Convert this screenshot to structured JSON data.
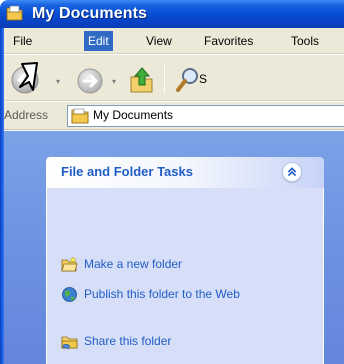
{
  "window": {
    "title": "My Documents",
    "title_icon": "folder-icon",
    "colors": {
      "titlebar": "#0a52d6",
      "menu_highlight": "#316ac5",
      "pane": "#6b8fe0",
      "link": "#215dc6"
    }
  },
  "menubar": {
    "items": [
      {
        "label": "File",
        "active": false
      },
      {
        "label": "Edit",
        "active": true
      },
      {
        "label": "View",
        "active": false
      },
      {
        "label": "Favorites",
        "active": false
      },
      {
        "label": "Tools",
        "active": false
      }
    ]
  },
  "toolbar": {
    "buttons": [
      {
        "name": "back-button",
        "icon": "back-arrow-icon"
      },
      {
        "name": "forward-button",
        "icon": "forward-arrow-icon"
      },
      {
        "name": "up-button",
        "icon": "up-folder-icon"
      },
      {
        "name": "search-button",
        "icon": "search-icon",
        "label": "S"
      }
    ]
  },
  "address": {
    "label": "Address",
    "value": "My Documents",
    "icon": "folder-icon"
  },
  "task_pane": {
    "title": "File and Folder Tasks",
    "collapse_icon": "chevron-up-double-icon",
    "tasks": [
      {
        "label": "Make a new folder",
        "icon": "new-folder-icon"
      },
      {
        "label": "Publish this folder to the Web",
        "icon": "globe-icon"
      },
      {
        "label": "Share this folder",
        "icon": "share-folder-icon"
      }
    ]
  }
}
